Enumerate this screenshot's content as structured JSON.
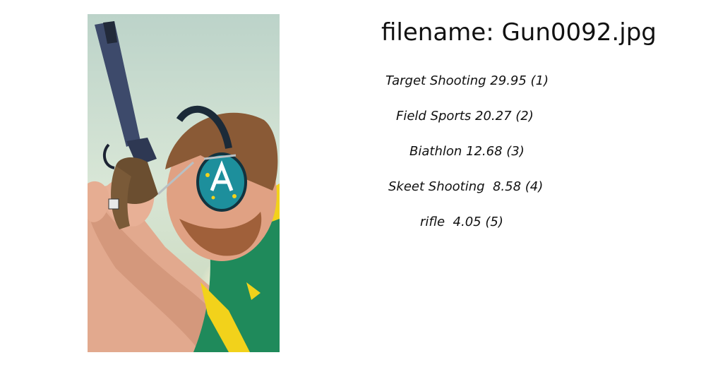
{
  "header": {
    "filename_label": "filename: Gun0092.jpg"
  },
  "predictions": [
    {
      "text": "Target Shooting 29.95 (1)",
      "label": "Target Shooting",
      "score": 29.95,
      "rank": 1
    },
    {
      "text": "Field Sports 20.27 (2)",
      "label": "Field Sports",
      "score": 20.27,
      "rank": 2
    },
    {
      "text": "Biathlon 12.68 (3)",
      "label": "Biathlon",
      "score": 12.68,
      "rank": 3
    },
    {
      "text": "Skeet Shooting  8.58 (4)",
      "label": "Skeet Shooting",
      "score": 8.58,
      "rank": 4
    },
    {
      "text": "rifle  4.05 (5)",
      "label": "rifle",
      "score": 4.05,
      "rank": 5
    }
  ],
  "image": {
    "headgear_icon": "earmuff-icon",
    "colors": {
      "background": "#c9d8c8",
      "jersey_green": "#1f8a5b",
      "jersey_gold": "#f2d21b",
      "earmuff_teal": "#1d8f9c"
    }
  }
}
